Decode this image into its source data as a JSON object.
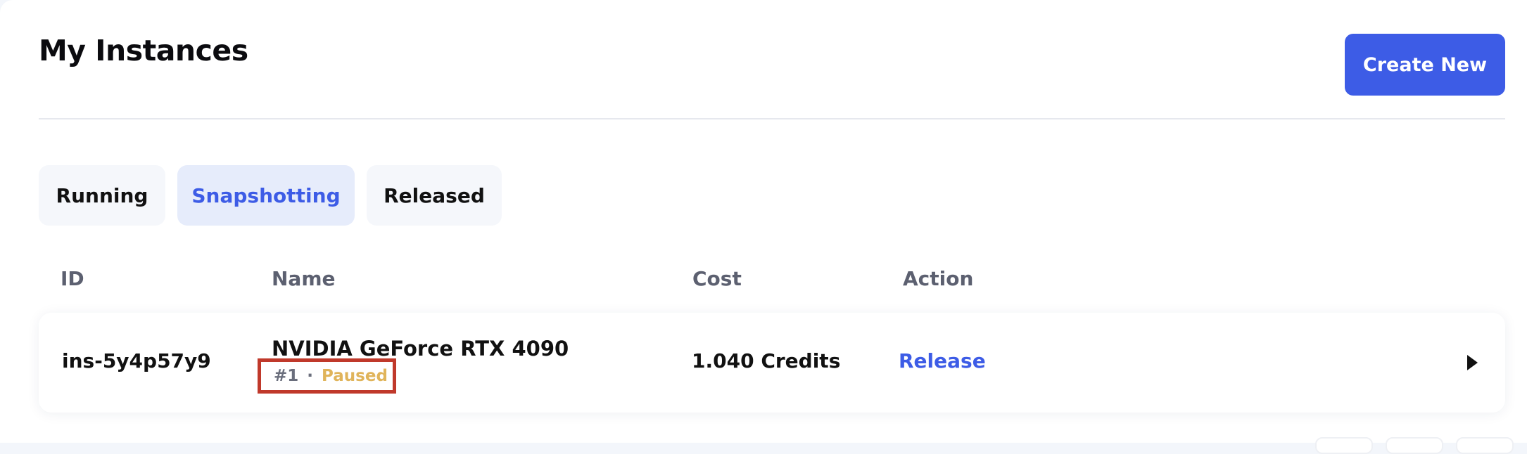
{
  "header": {
    "title": "My Instances",
    "create_label": "Create New"
  },
  "tabs": [
    {
      "label": "Running",
      "active": false
    },
    {
      "label": "Snapshotting",
      "active": true
    },
    {
      "label": "Released",
      "active": false
    }
  ],
  "table": {
    "columns": [
      "ID",
      "Name",
      "Cost",
      "Action"
    ],
    "rows": [
      {
        "id": "ins-5y4p57y9",
        "name": "NVIDIA GeForce RTX 4090",
        "index": "#1",
        "separator": "·",
        "status": "Paused",
        "cost": "1.040 Credits",
        "action": "Release"
      }
    ]
  },
  "colors": {
    "accent": "#3d5ce6",
    "active_tab_bg": "#e6ecfb",
    "status_paused": "#e0b45a",
    "highlight_box": "#c0392b"
  },
  "icons": {
    "expand": "caret-right-icon"
  }
}
